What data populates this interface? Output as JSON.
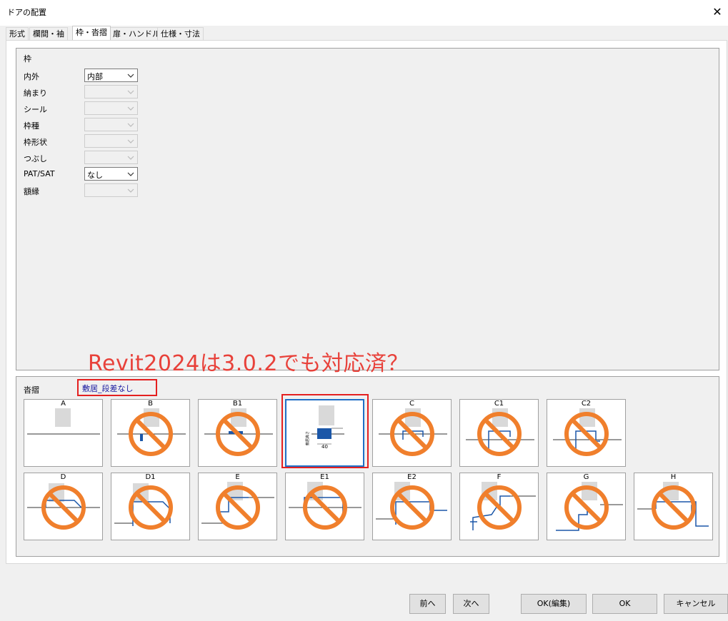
{
  "window": {
    "title": "ドアの配置",
    "close_glyph": "✕"
  },
  "tabs": [
    {
      "label": "形式"
    },
    {
      "label": "欄間・袖"
    },
    {
      "label": "枠・沓摺"
    },
    {
      "label": "扉・ハンドル"
    },
    {
      "label": "仕様・寸法"
    }
  ],
  "active_tab": 2,
  "frame_group": {
    "title": "枠",
    "fields": [
      {
        "label": "内外",
        "value": "内部",
        "enabled": true
      },
      {
        "label": "納まり",
        "value": "",
        "enabled": false
      },
      {
        "label": "シール",
        "value": "",
        "enabled": false
      },
      {
        "label": "枠種",
        "value": "",
        "enabled": false
      },
      {
        "label": "枠形状",
        "value": "",
        "enabled": false
      },
      {
        "label": "つぶし",
        "value": "",
        "enabled": false
      },
      {
        "label": "PAT/SAT",
        "value": "なし",
        "enabled": true
      },
      {
        "label": "額縁",
        "value": "",
        "enabled": false
      }
    ]
  },
  "annotation": {
    "text": "Revit2024は3.0.2でも対応済？",
    "color": "#e8413a"
  },
  "sill_group": {
    "title": "沓摺",
    "selected_name": "敷居_段差なし",
    "tiles_row1": [
      {
        "label": "A",
        "prohibited": false
      },
      {
        "label": "B",
        "prohibited": true
      },
      {
        "label": "B1",
        "prohibited": true
      },
      {
        "label": "",
        "prohibited": false,
        "selected": true,
        "dim_label": "40",
        "side_label": "敷居高さ"
      },
      {
        "label": "C",
        "prohibited": true
      },
      {
        "label": "C1",
        "prohibited": true
      },
      {
        "label": "C2",
        "prohibited": true
      }
    ],
    "tiles_row2": [
      {
        "label": "D",
        "prohibited": true
      },
      {
        "label": "D1",
        "prohibited": true
      },
      {
        "label": "E",
        "prohibited": true
      },
      {
        "label": "E1",
        "prohibited": true
      },
      {
        "label": "E2",
        "prohibited": true
      },
      {
        "label": "F",
        "prohibited": true
      },
      {
        "label": "G",
        "prohibited": true
      },
      {
        "label": "H",
        "prohibited": true
      }
    ]
  },
  "buttons": {
    "prev": "前へ",
    "next": "次へ",
    "ok_edit": "OK(編集)",
    "ok": "OK",
    "cancel": "キャンセル"
  },
  "colors": {
    "prohibit_orange": "#f07f2c",
    "highlight_red": "#e42020",
    "selected_blue": "#1f6fc6",
    "sill_blue": "#1b57a8"
  }
}
